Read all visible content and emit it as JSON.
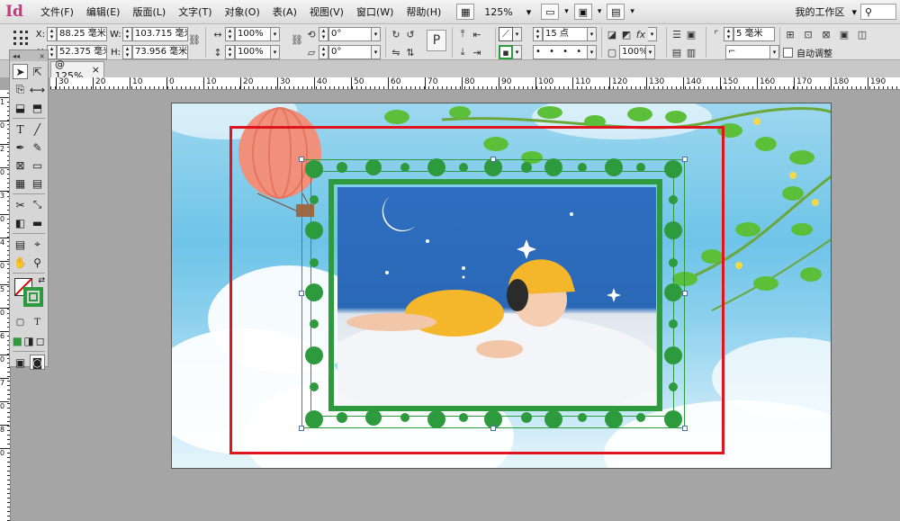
{
  "app": {
    "logo": "Id"
  },
  "menu": [
    "文件(F)",
    "编辑(E)",
    "版面(L)",
    "文字(T)",
    "对象(O)",
    "表(A)",
    "视图(V)",
    "窗口(W)",
    "帮助(H)"
  ],
  "menubar": {
    "zoom": "125%",
    "workspace": "我的工作区"
  },
  "control": {
    "x_label": "X:",
    "x": "88.25 毫米",
    "y_label": "Y:",
    "y": "52.375 毫米",
    "w_label": "W:",
    "w": "103.715 毫米",
    "h_label": "H:",
    "h": "73.956 毫米",
    "scale_x": "100%",
    "scale_y": "100%",
    "rotate": "0°",
    "shear": "0°",
    "stroke_weight": "15 点",
    "opacity": "100%",
    "offset": "5 毫米",
    "autofit_label": "自动调整"
  },
  "tab": {
    "label": "@ 125%",
    "close": "×"
  },
  "ruler": {
    "h_ticks": [
      "30",
      "20",
      "10",
      "0",
      "10",
      "20",
      "30",
      "40",
      "50",
      "60",
      "70",
      "80",
      "90",
      "100",
      "110",
      "120",
      "130",
      "140",
      "150",
      "160",
      "170",
      "180",
      "190"
    ],
    "v_ticks": [
      "1",
      "0",
      "2",
      "0",
      "3",
      "0",
      "4",
      "0",
      "5",
      "0",
      "6",
      "0",
      "7",
      "0",
      "8",
      "0"
    ]
  },
  "tools": {
    "header_arrows": "◂◂",
    "header_close": "×"
  },
  "colors": {
    "selection": "#e0141c",
    "frame_green": "#2e9a3e",
    "sky": "#6ec4e8"
  }
}
